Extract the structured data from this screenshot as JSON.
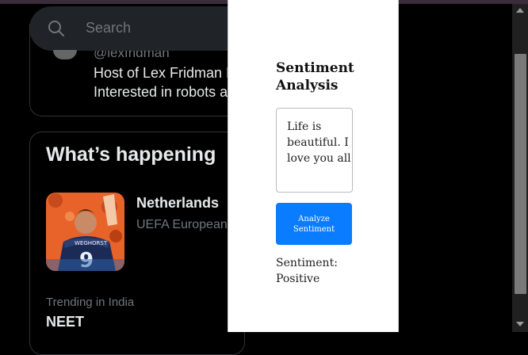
{
  "search": {
    "placeholder": "Search"
  },
  "profile": {
    "handle": "@lexfridman",
    "bio_lines": [
      "Host of Lex Fridman Podcast.",
      "Interested in robots and humans."
    ]
  },
  "trends": {
    "title": "What’s happening",
    "items": [
      {
        "name": "Netherlands",
        "subtitle": "UEFA European Championship"
      },
      {
        "context": "Trending in India",
        "topic": "NEET"
      }
    ]
  },
  "popup": {
    "title": "Sentiment Analysis",
    "input_value": "Life is beautiful. I love you all",
    "button_label": "Analyze Sentiment",
    "result_text": "Sentiment: Positive",
    "button_color": "#0a7cff"
  }
}
